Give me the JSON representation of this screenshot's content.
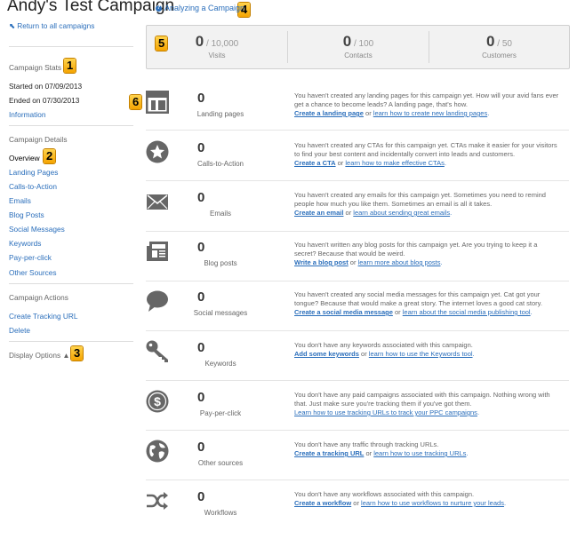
{
  "page": {
    "title": "Andy's Test Campaign",
    "help_link": "Analyzing a Campaign",
    "back_link": "Return to all campaigns"
  },
  "badges": [
    "1",
    "2",
    "3",
    "4",
    "5",
    "6"
  ],
  "sidebar": {
    "stats_header": "Campaign Stats",
    "started": "Started on 07/09/2013",
    "ended": "Ended on 07/30/2013",
    "information": "Information",
    "details_header": "Campaign Details",
    "detail_items": [
      "Overview",
      "Landing Pages",
      "Calls-to-Action",
      "Emails",
      "Blog Posts",
      "Social Messages",
      "Keywords",
      "Pay-per-click",
      "Other Sources"
    ],
    "actions_header": "Campaign Actions",
    "action_items": [
      "Create Tracking URL",
      "Delete"
    ],
    "display_options": "Display Options ▲"
  },
  "stats": [
    {
      "value": "0",
      "total": "/ 10,000",
      "label": "Visits"
    },
    {
      "value": "0",
      "total": "/ 100",
      "label": "Contacts"
    },
    {
      "value": "0",
      "total": "/ 50",
      "label": "Customers"
    }
  ],
  "assets": [
    {
      "icon": "landing-page-icon",
      "count": "0",
      "label": "Landing pages",
      "desc": "You haven't created any landing pages for this campaign yet. How will your avid fans ever get a chance to become leads? A landing page, that's how.",
      "action": "Create a landing page",
      "or": " or ",
      "learn": "learn how to create new landing pages",
      "end": "."
    },
    {
      "icon": "cta-star-icon",
      "count": "0",
      "label": "Calls-to-Action",
      "desc": "You haven't created any CTAs for this campaign yet. CTAs make it easier for your visitors to find your best content and incidentally convert into leads and customers.",
      "action": "Create a CTA",
      "or": " or ",
      "learn": "learn how to make effective CTAs",
      "end": "."
    },
    {
      "icon": "email-envelope-icon",
      "count": "0",
      "label": "Emails",
      "desc": "You haven't created any emails for this campaign yet. Sometimes you need to remind people how much you like them. Sometimes an email is all it takes.",
      "action": "Create an email",
      "or": " or ",
      "learn": "learn about sending great emails",
      "end": "."
    },
    {
      "icon": "blog-post-icon",
      "count": "0",
      "label": "Blog posts",
      "desc": "You haven't written any blog posts for this campaign yet. Are you trying to keep it a secret? Because that would be weird.",
      "action": "Write a blog post",
      "or": " or ",
      "learn": "learn more about blog posts",
      "end": "."
    },
    {
      "icon": "speech-bubble-icon",
      "count": "0",
      "label": "Social messages",
      "desc": "You haven't created any social media messages for this campaign yet. Cat got your tongue? Because that would make a great story. The internet loves a good cat story.",
      "action": "Create a social media message",
      "or": " or ",
      "learn": "learn about the social media publishing tool",
      "end": "."
    },
    {
      "icon": "key-icon",
      "count": "0",
      "label": "Keywords",
      "desc": "You don't have any keywords associated with this campaign.",
      "action": "Add some keywords",
      "or": " or ",
      "learn": "learn how to use the Keywords tool",
      "end": "."
    },
    {
      "icon": "dollar-coin-icon",
      "count": "0",
      "label": "Pay-per-click",
      "desc": "You don't have any paid campaigns associated with this campaign. Nothing wrong with that. Just make sure you're tracking them if you've got them.",
      "action": "",
      "or": "",
      "learn": "Learn how to use tracking URLs to track your PPC campaigns",
      "end": "."
    },
    {
      "icon": "globe-icon",
      "count": "0",
      "label": "Other sources",
      "desc": "You don't have any traffic through tracking URLs.",
      "action": "Create a tracking URL",
      "or": " or ",
      "learn": "learn how to use tracking URLs",
      "end": "."
    },
    {
      "icon": "shuffle-workflow-icon",
      "count": "0",
      "label": "Workflows",
      "desc": "You don't have any workflows associated with this campaign.",
      "action": "Create a workflow",
      "or": " or ",
      "learn": "learn how to use workflows to nurture your leads",
      "end": "."
    }
  ],
  "colors": {
    "link": "#2a6ebb",
    "icon": "#666666",
    "panel": "#f2f2f2"
  }
}
